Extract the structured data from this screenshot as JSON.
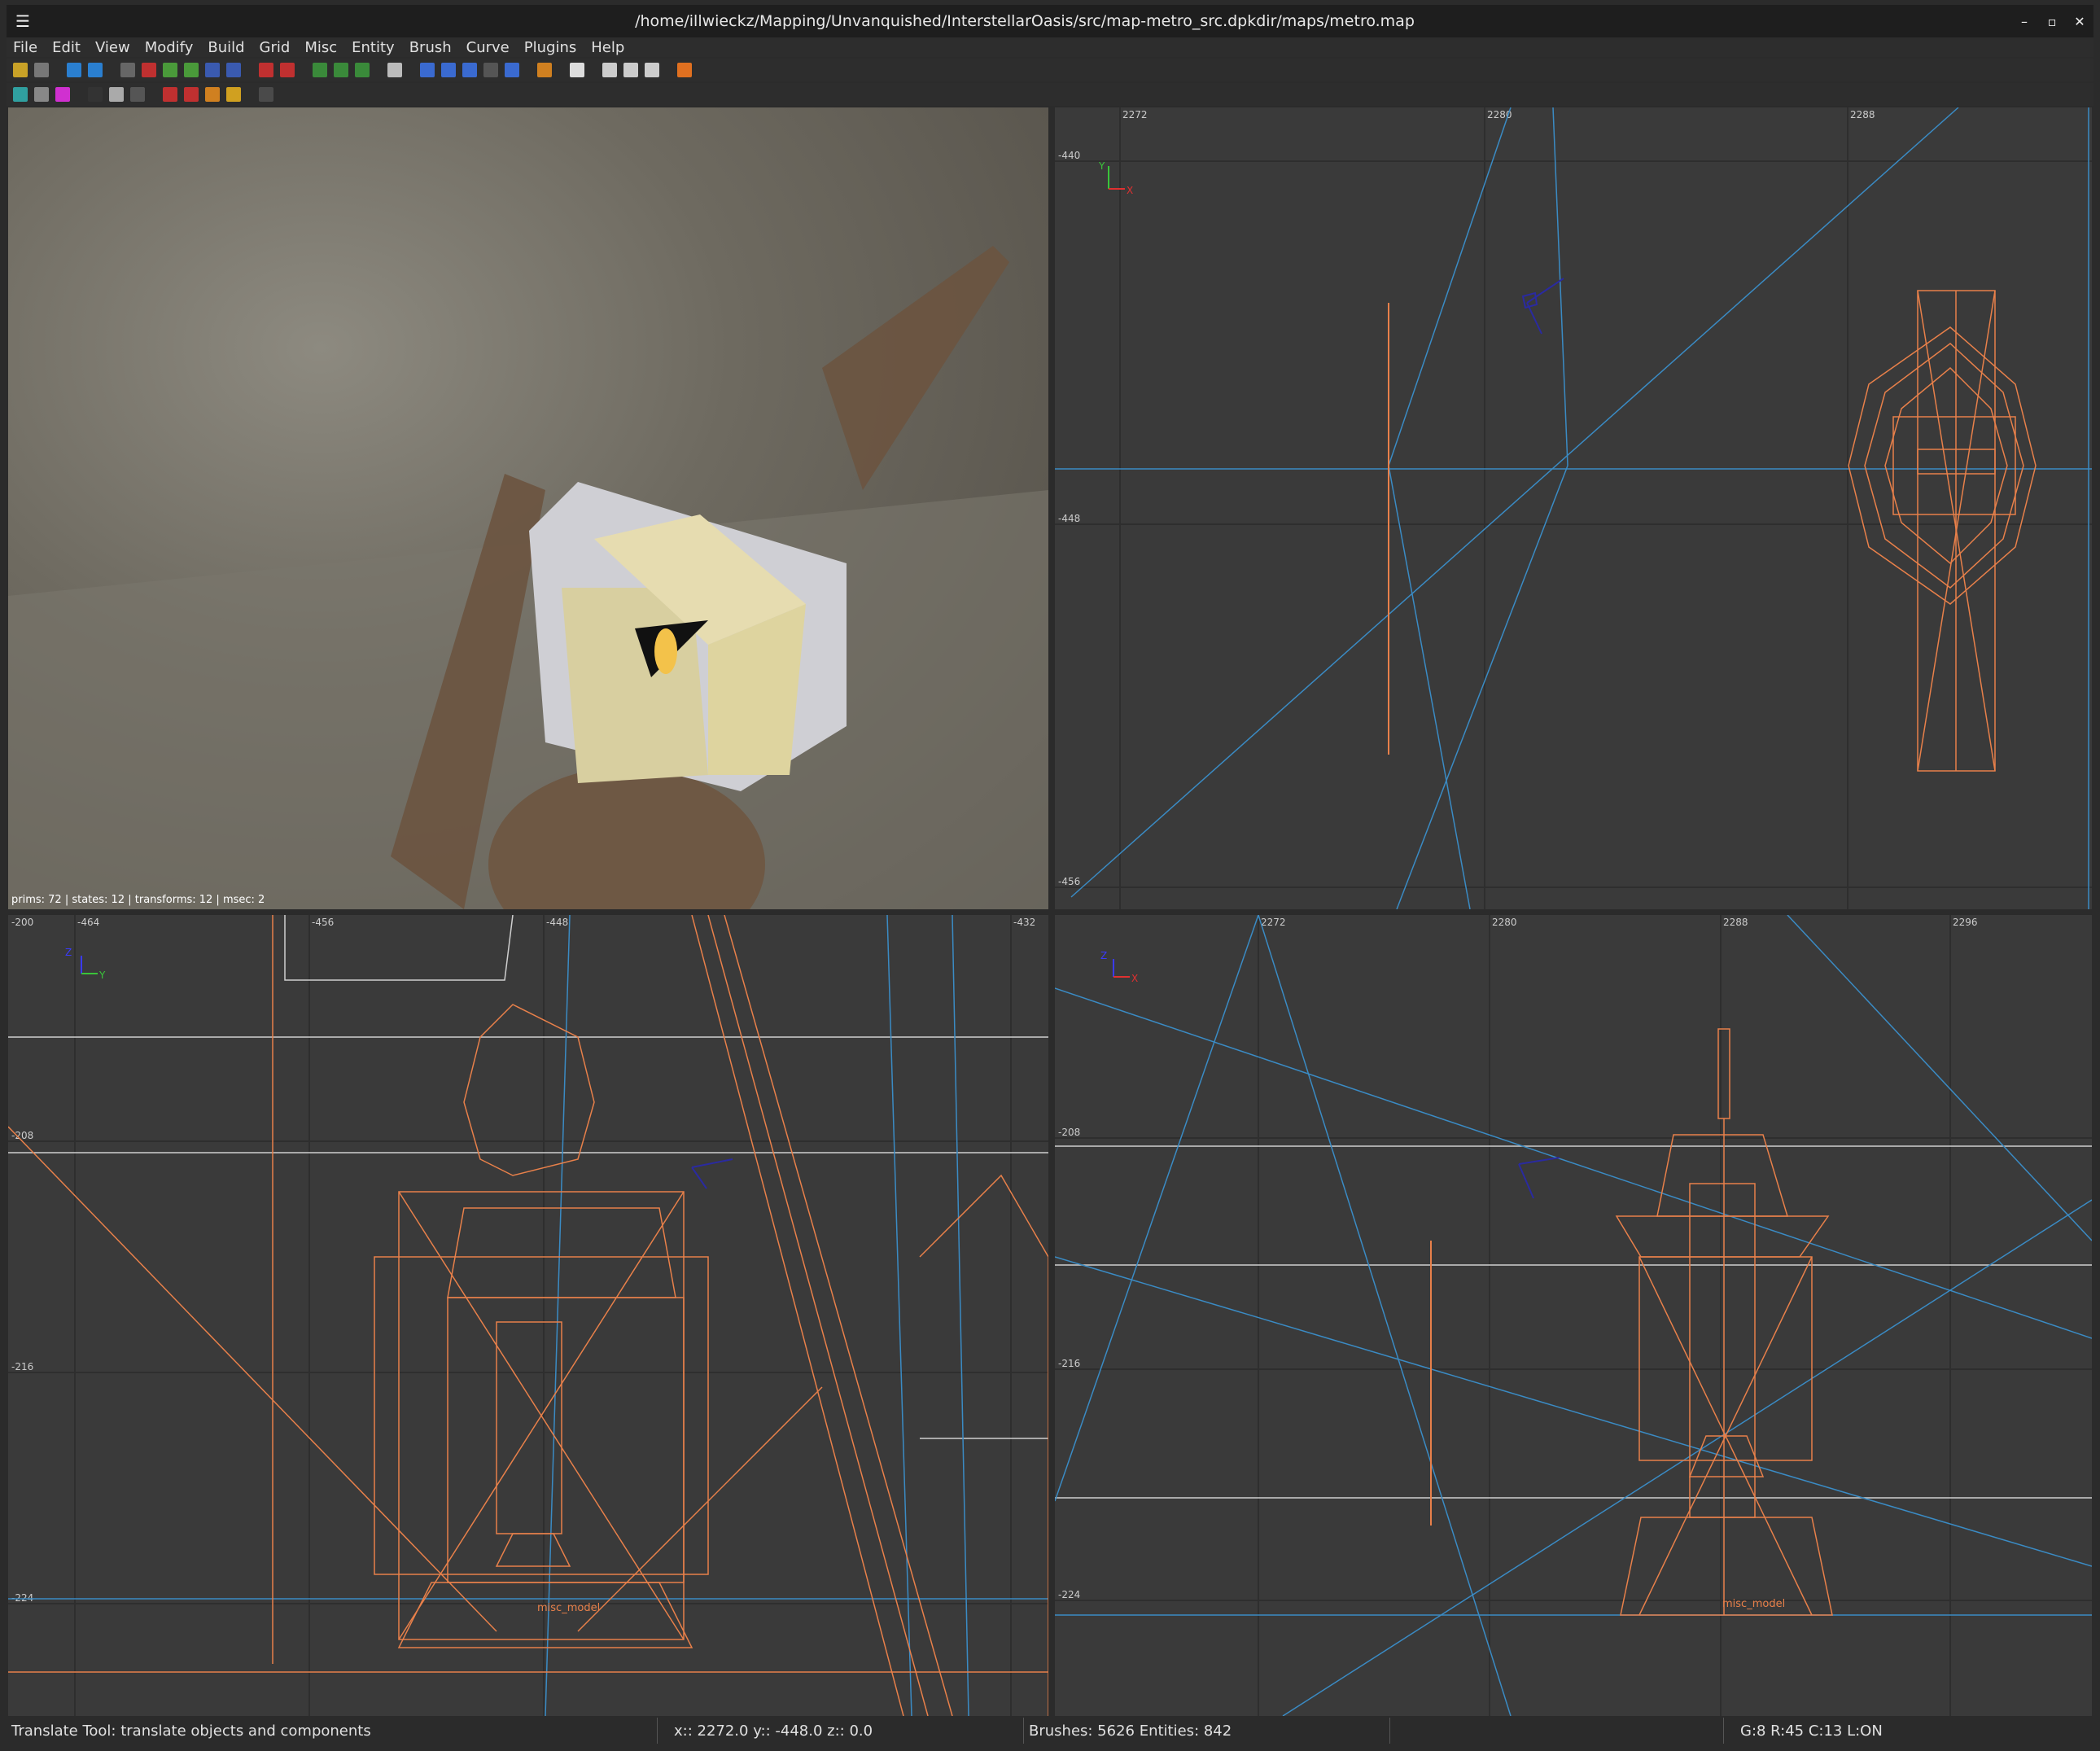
{
  "window": {
    "title": "/home/illwieckz/Mapping/Unvanquished/InterstellarOasis/src/map-metro_src.dpkdir/maps/metro.map",
    "menu_glyph": "☰",
    "minimize": "–",
    "maximize": "▫",
    "close": "✕"
  },
  "menubar": {
    "items": [
      "File",
      "Edit",
      "View",
      "Modify",
      "Build",
      "Grid",
      "Misc",
      "Entity",
      "Brush",
      "Curve",
      "Plugins",
      "Help"
    ]
  },
  "camera": {
    "stats": "prims: 72 | states: 12 | transforms: 12 | msec: 2"
  },
  "top_view": {
    "x_ticks": [
      2272,
      2280,
      2288
    ],
    "y_ticks": [
      -440,
      -448,
      -456
    ],
    "axis_labels": [
      "Y",
      "X"
    ]
  },
  "front_view": {
    "x_ticks": [
      -464,
      -456,
      -448,
      -432
    ],
    "x_tick_first": "-200",
    "y_ticks": [
      -208,
      -216,
      -224
    ],
    "axis_labels": [
      "Z",
      "Y"
    ],
    "entity_label": "misc_model"
  },
  "side_view": {
    "x_ticks": [
      2272,
      2280,
      2288,
      2296
    ],
    "y_ticks": [
      -208,
      -216,
      -224
    ],
    "axis_labels": [
      "Z",
      "X"
    ],
    "entity_label": "misc_model"
  },
  "colors": {
    "wire_orange": "#e8804a",
    "wire_blue": "#3a8bc4",
    "grid_major": "#555555",
    "grid_white": "#cfcfcf",
    "view_bg": "#3a3a3a"
  },
  "statusbar": {
    "tool": "Translate Tool: translate objects and components",
    "coords": "x:: 2272.0  y:: -448.0  z::    0.0",
    "counts": "Brushes: 5626 Entities: 842",
    "grid": "G:8  R:45  C:13  L:ON"
  }
}
